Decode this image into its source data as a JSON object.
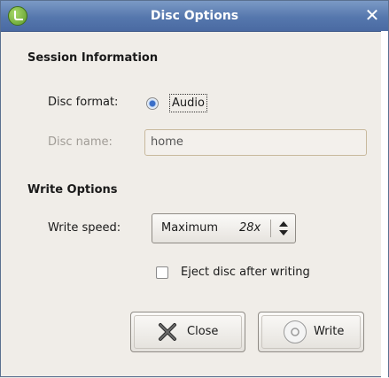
{
  "window": {
    "title": "Disc Options"
  },
  "session": {
    "heading": "Session Information",
    "disc_format_label": "Disc format:",
    "disc_format_value": "Audio",
    "disc_name_label": "Disc name:",
    "disc_name_value": "home"
  },
  "write_options": {
    "heading": "Write Options",
    "speed_label": "Write speed:",
    "speed_value": "Maximum",
    "speed_x": "28x",
    "eject_label": "Eject disc after writing",
    "eject_checked": false
  },
  "buttons": {
    "close_label": "Close",
    "write_label": "Write"
  },
  "icons": {
    "app": "brasero-app-icon",
    "close_window": "close-icon",
    "close_button": "x-icon",
    "write_button": "disc-icon",
    "combo": "spin-arrows-icon"
  },
  "colors": {
    "titlebar": "#5577ad",
    "radio_selected": "#3a6ec8"
  }
}
